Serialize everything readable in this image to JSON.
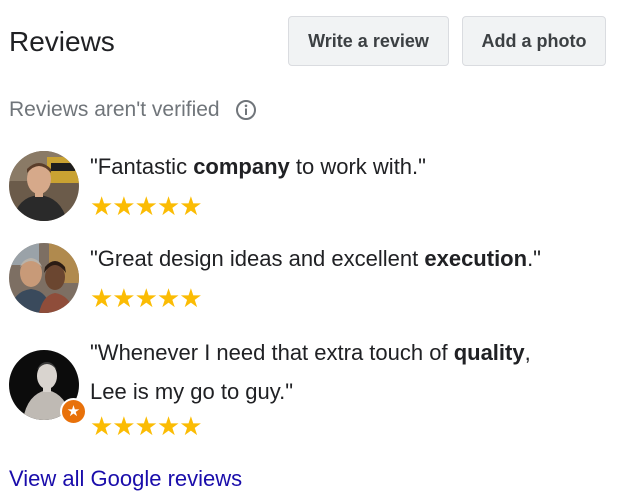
{
  "header": {
    "title": "Reviews",
    "write_review_label": "Write a review",
    "add_photo_label": "Add a photo"
  },
  "notice": {
    "text": "Reviews aren't verified",
    "icon": "info-icon"
  },
  "reviews": [
    {
      "quote_open": "\"Fantastic ",
      "quote_bold": "company",
      "quote_close": " to work with.\"",
      "rating": 5,
      "stars": "★★★★★"
    },
    {
      "quote_open": "\"Great design ideas and excellent ",
      "quote_bold": "execution",
      "quote_close": ".\"",
      "rating": 5,
      "stars": "★★★★★"
    },
    {
      "quote_open": "\"Whenever I need that extra touch of ",
      "quote_bold": "quality",
      "quote_close": ",",
      "quote_line2": "Lee is my go to guy.\"",
      "rating": 5,
      "stars": "★★★★★",
      "badge_icon": "local-guide-star-icon"
    }
  ],
  "footer": {
    "view_all_label": "View all Google reviews"
  },
  "colors": {
    "star": "#fbbc04",
    "link": "#1a0dab",
    "muted": "#70757a",
    "button_bg": "#f1f3f4",
    "badge": "#e8710a"
  }
}
